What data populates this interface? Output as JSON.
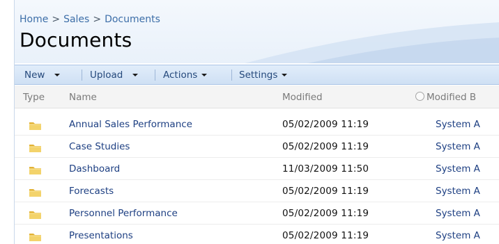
{
  "breadcrumb": {
    "items": [
      "Home",
      "Sales",
      "Documents"
    ],
    "separator": ">"
  },
  "page_title": "Documents",
  "toolbar": {
    "new": "New",
    "upload": "Upload",
    "actions": "Actions",
    "settings": "Settings"
  },
  "columns": {
    "type": "Type",
    "name": "Name",
    "modified": "Modified",
    "modified_by": "Modified B"
  },
  "rows": [
    {
      "name": "Annual Sales Performance",
      "modified": "05/02/2009 11:19",
      "modified_by": "System A",
      "icon": "folder-icon"
    },
    {
      "name": "Case Studies",
      "modified": "05/02/2009 11:19",
      "modified_by": "System A",
      "icon": "folder-icon"
    },
    {
      "name": "Dashboard",
      "modified": "11/03/2009 11:50",
      "modified_by": "System A",
      "icon": "folder-icon"
    },
    {
      "name": "Forecasts",
      "modified": "05/02/2009 11:19",
      "modified_by": "System A",
      "icon": "folder-icon"
    },
    {
      "name": "Personnel Performance",
      "modified": "05/02/2009 11:19",
      "modified_by": "System A",
      "icon": "folder-icon"
    },
    {
      "name": "Presentations",
      "modified": "05/02/2009 11:19",
      "modified_by": "System A",
      "icon": "folder-icon"
    }
  ],
  "colors": {
    "link": "#1d3f82",
    "breadcrumb": "#3d6ea8",
    "toolbar_text": "#25497c",
    "toolbar_bg": "#d6e5f6",
    "folder": "#f0c84a"
  }
}
